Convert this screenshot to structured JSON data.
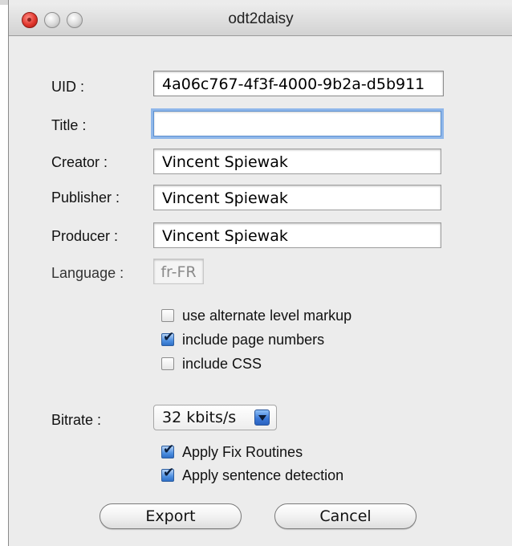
{
  "window": {
    "title": "odt2daisy"
  },
  "form": {
    "uid_label": "UID :",
    "uid_value": "4a06c767-4f3f-4000-9b2a-d5b911",
    "title_label": "Title :",
    "title_value": "",
    "creator_label": "Creator :",
    "creator_value": "Vincent Spiewak",
    "publisher_label": "Publisher :",
    "publisher_value": "Vincent Spiewak",
    "producer_label": "Producer :",
    "producer_value": "Vincent Spiewak",
    "language_label": "Language :",
    "language_value": "fr-FR"
  },
  "options": [
    {
      "label": "use alternate level markup",
      "checked": false
    },
    {
      "label": "include page numbers",
      "checked": true
    },
    {
      "label": "include CSS",
      "checked": false
    }
  ],
  "bitrate": {
    "label": "Bitrate :",
    "selected": "32 kbits/s"
  },
  "audio_options": [
    {
      "label": "Apply Fix Routines",
      "checked": true
    },
    {
      "label": "Apply sentence detection",
      "checked": true
    }
  ],
  "buttons": {
    "export": "Export",
    "cancel": "Cancel"
  },
  "icons": {
    "checkmark": "✔",
    "colors": {
      "close": "#e0362d",
      "focus_ring": "#8fb7ea",
      "checkbox_on": "#4d8fe0"
    }
  }
}
